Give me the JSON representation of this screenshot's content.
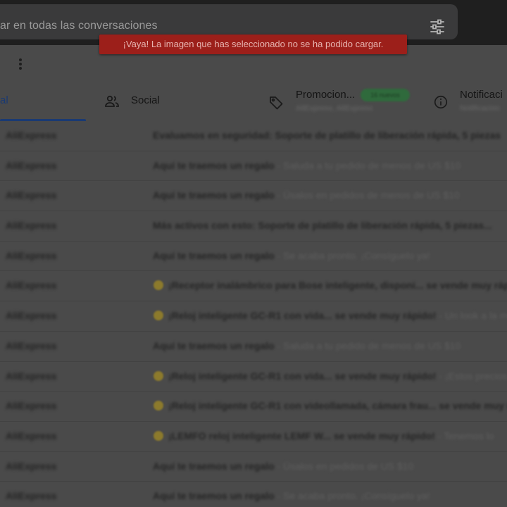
{
  "search": {
    "placeholder": "ar en todas las conversaciones"
  },
  "toast": {
    "message": "¡Vaya! La imagen que has seleccionado no se ha podido cargar."
  },
  "tabs": [
    {
      "label": "al",
      "icon": "inbox-icon",
      "selected": true
    },
    {
      "label": "Social",
      "icon": "people-icon",
      "selected": false
    },
    {
      "label": "Promocion...",
      "icon": "tag-icon",
      "selected": false,
      "badge": "16 nuevos",
      "subtext": "AliExpress, AliExpress"
    },
    {
      "label": "Notificaci",
      "icon": "info-icon",
      "selected": false,
      "subtext": "Notificacion"
    }
  ],
  "emails": [
    {
      "sender": "AliExpress",
      "emoji": false,
      "subject": "Evaluamos en seguridad: Soporte de platillo de liberación rápida, 5 piezas",
      "snippet": ""
    },
    {
      "sender": "AliExpress",
      "emoji": false,
      "subject": "Aquí te traemos un regalo",
      "snippet": " - Saluda a tu pedido de menos de US $10"
    },
    {
      "sender": "AliExpress",
      "emoji": false,
      "subject": "Aquí te traemos un regalo",
      "snippet": " - Úsalos en pedidos de menos de US $10"
    },
    {
      "sender": "AliExpress",
      "emoji": false,
      "subject": "Más activos con esto: Soporte de platillo de liberación rápida, 5 piezas...",
      "snippet": ""
    },
    {
      "sender": "AliExpress",
      "emoji": false,
      "subject": "Aquí te traemos un regalo",
      "snippet": " - Se acaba pronto. ¡Consíguelo ya!"
    },
    {
      "sender": "AliExpress",
      "emoji": true,
      "subject": "¡Receptor inalámbrico para Bose inteligente, disponi... se vende muy rápido",
      "snippet": ""
    },
    {
      "sender": "AliExpress",
      "emoji": true,
      "subject": "¡Reloj inteligente GC-R1 con vida... se vende muy rápido!",
      "snippet": " - Un look a la moda"
    },
    {
      "sender": "AliExpress",
      "emoji": false,
      "subject": "Aquí te traemos un regalo",
      "snippet": " - Saluda a tu pedido de menos de US $10"
    },
    {
      "sender": "AliExpress",
      "emoji": true,
      "subject": "¡Reloj inteligente GC-R1 con vida... se vende muy rápido!",
      "snippet": " - ¡Estos precios"
    },
    {
      "sender": "AliExpress",
      "emoji": true,
      "subject": "¡Reloj inteligente GC-R1 con videollamada, cámara frau... se vende muy rápido",
      "snippet": ""
    },
    {
      "sender": "AliExpress",
      "emoji": true,
      "subject": "¡LEMFO reloj inteligente LEMF W... se vende muy rápido!",
      "snippet": " - Tenemos lo"
    },
    {
      "sender": "AliExpress",
      "emoji": false,
      "subject": "Aquí te traemos un regalo",
      "snippet": " - Úsalos en pedidos de US $10"
    },
    {
      "sender": "AliExpress",
      "emoji": false,
      "subject": "Aquí te traemos un regalo",
      "snippet": " - Se acaba pronto. ¡Consíguelo ya!"
    }
  ]
}
